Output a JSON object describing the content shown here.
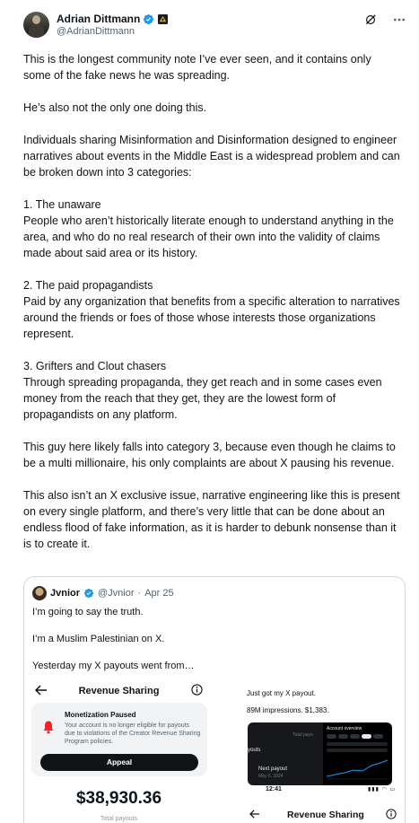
{
  "author": {
    "name": "Adrian Dittmann",
    "handle": "@AdrianDittmann"
  },
  "icons": {
    "verified": "verified-badge-icon",
    "affiliate": "affiliate-badge-icon",
    "grok": "grok-icon",
    "more": "more-options-icon",
    "back": "arrow-left-icon",
    "info": "info-icon",
    "bell": "bell-alert-icon"
  },
  "colors": {
    "verified": "#1d9bf0",
    "text": "#0f1419",
    "secondary": "#536471",
    "border": "#cfd9de"
  },
  "body": {
    "paragraphs": [
      "This is the longest community note I’ve ever seen, and it contains only some of the fake news he was spreading.",
      "He’s also not the only one doing this.",
      "Individuals sharing Misinformation and Disinformation designed to engineer narratives about events in the Middle East is a widespread problem and can be broken down into 3 categories:",
      "1. The unaware\nPeople who aren’t historically literate enough to understand anything in the area, and who do no real research of their own into the validity of claims made about said area or its history.",
      "2. The paid propagandists\nPaid by any organization that benefits from a specific alteration to narratives around the friends or foes of those whose interests those organizations represent.",
      "3. Grifters and Clout chasers\nThrough spreading propaganda, they get reach and in some cases even money from the reach that they get, they are the lowest form of propagandists on any platform.",
      "This guy here likely falls into category 3, because even though he claims to be a multi millionaire, his only complaints are about X pausing his revenue.",
      "This also isn’t an X exclusive issue, narrative engineering like this is present on every single platform, and there’s very little that can be done about an endless flood of fake information, as it is harder to debunk nonsense than it is to create it."
    ]
  },
  "quote": {
    "name": "Jvnior",
    "handle": "@Jvnior",
    "separator": "·",
    "date": "Apr 25",
    "lines": [
      "I’m going to say the truth.",
      "I’m a Muslim Palestinian on X.",
      "Yesterday my X payouts went from…"
    ],
    "media_left": {
      "title": "Revenue Sharing",
      "paused_title": "Monetization Paused",
      "paused_desc": "Your account is no longer eligible for payouts due to violations of the Creator Revenue Sharing Program policies.",
      "appeal_label": "Appeal",
      "amount": "$38,930.36",
      "amount_label": "Total payouts"
    },
    "media_right": {
      "caption1": "Just got my X payout.",
      "caption2": "89M impressions. $1,383.",
      "label_total": "Total payo",
      "label_payouts": "youts",
      "label_next": "Next payout",
      "label_date": "May 6, 2024",
      "overview_title": "Account overview",
      "status_time": "12:41",
      "status_icons": "▮▮▮ ◠ ▭",
      "title": "Revenue Sharing"
    }
  }
}
